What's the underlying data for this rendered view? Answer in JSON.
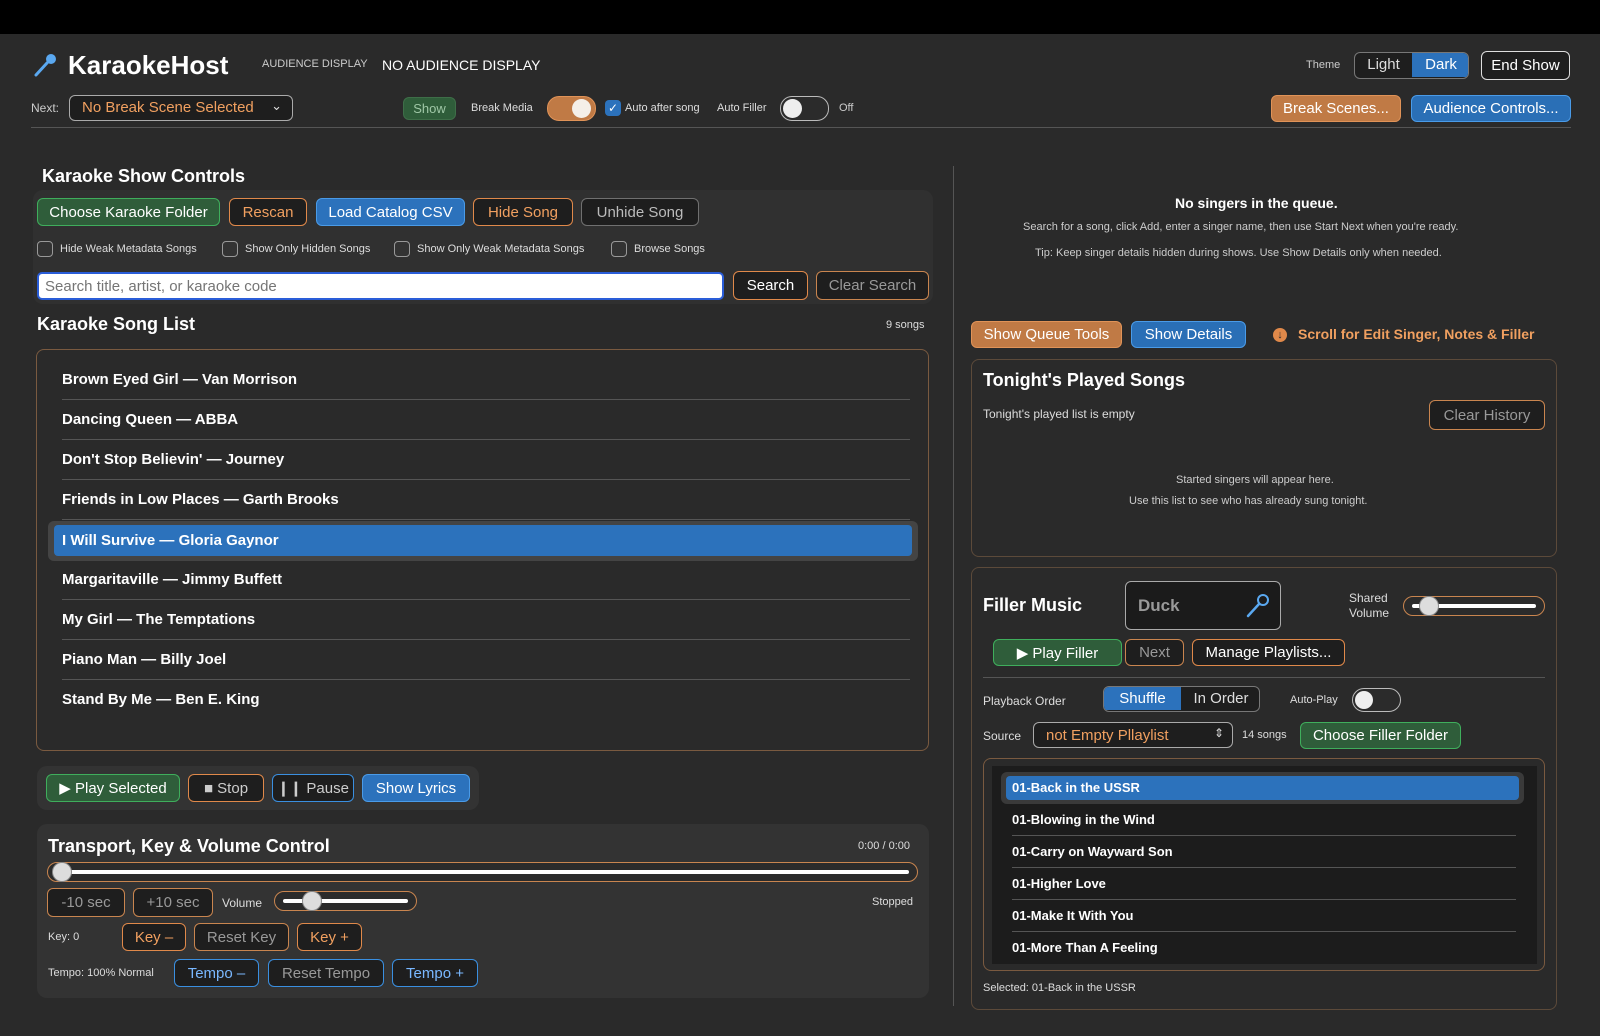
{
  "header": {
    "app_title": "KaraokeHost",
    "audience_display_label": "AUDIENCE DISPLAY",
    "audience_display_value": "NO AUDIENCE DISPLAY",
    "theme_label": "Theme",
    "theme_light": "Light",
    "theme_dark": "Dark",
    "end_show": "End Show",
    "next_label": "Next:",
    "next_select": "No Break Scene Selected",
    "show_btn": "Show",
    "break_media_label": "Break Media",
    "auto_after_song_label": "Auto after song",
    "auto_filler_label": "Auto Filler",
    "auto_filler_state": "Off",
    "break_scenes": "Break Scenes...",
    "audience_controls": "Audience Controls..."
  },
  "controls": {
    "title": "Karaoke Show Controls",
    "choose_folder": "Choose Karaoke Folder",
    "rescan": "Rescan",
    "load_csv": "Load Catalog CSV",
    "hide_song": "Hide Song",
    "unhide_song": "Unhide Song",
    "filters": [
      "Hide Weak Metadata Songs",
      "Show Only Hidden Songs",
      "Show Only Weak Metadata Songs",
      "Browse Songs"
    ],
    "search_placeholder": "Search title, artist, or karaoke code",
    "search_btn": "Search",
    "clear_search_btn": "Clear Search"
  },
  "song_list": {
    "title": "Karaoke Song List",
    "count": "9 songs",
    "songs": [
      "Brown Eyed Girl — Van Morrison",
      "Dancing Queen — ABBA",
      "Don't Stop Believin' — Journey",
      "Friends in Low Places — Garth Brooks",
      "I Will Survive — Gloria Gaynor",
      "Margaritaville — Jimmy Buffett",
      "My Girl — The Temptations",
      "Piano Man — Billy Joel",
      "Stand By Me — Ben E. King"
    ],
    "selected_index": 4
  },
  "playback": {
    "play_selected": "▶ Play Selected",
    "stop": "■ Stop",
    "pause": "❙❙ Pause",
    "show_lyrics": "Show Lyrics"
  },
  "transport": {
    "title": "Transport, Key & Volume Control",
    "time": "0:00 / 0:00",
    "back10": "-10 sec",
    "fwd10": "+10 sec",
    "volume_label": "Volume",
    "status": "Stopped",
    "key_label": "Key: 0",
    "key_down": "Key –",
    "reset_key": "Reset Key",
    "key_up": "Key +",
    "tempo_label": "Tempo: 100% Normal",
    "tempo_down": "Tempo –",
    "reset_tempo": "Reset Tempo",
    "tempo_up": "Tempo +",
    "position_fraction": 0.0,
    "volume_fraction": 0.2
  },
  "queue": {
    "empty_title": "No singers in the queue.",
    "empty_hint": "Search for a song, click Add, enter a singer name, then use Start Next when you're ready.",
    "tip": "Tip: Keep singer details hidden during shows. Use Show Details only when needed.",
    "show_queue_tools": "Show Queue Tools",
    "show_details": "Show Details",
    "scroll_hint": "Scroll for Edit Singer, Notes & Filler"
  },
  "played": {
    "title": "Tonight's Played Songs",
    "empty": "Tonight's played list is empty",
    "clear_history": "Clear History",
    "hint1": "Started singers will appear here.",
    "hint2": "Use this list to see who has already sung tonight."
  },
  "filler": {
    "title": "Filler Music",
    "duck": "Duck",
    "shared_volume_label_1": "Shared",
    "shared_volume_label_2": "Volume",
    "shared_volume_fraction": 0.1,
    "play_filler": "▶  Play Filler",
    "next": "Next",
    "manage_playlists": "Manage Playlists...",
    "playback_order_label": "Playback Order",
    "shuffle": "Shuffle",
    "in_order": "In Order",
    "auto_play_label": "Auto-Play",
    "source_label": "Source",
    "source_value": "not Empty Pllaylist",
    "song_count": "14 songs",
    "choose_folder": "Choose Filler Folder",
    "songs": [
      "01-Back in the USSR",
      "01-Blowing in the Wind",
      "01-Carry on Wayward Son",
      "01-Higher Love",
      "01-Make It With You",
      "01-More Than A Feeling"
    ],
    "selected_index": 0,
    "selected_text": "Selected: 01-Back in the USSR"
  },
  "colors": {
    "accent_blue": "#2c72bc",
    "accent_orange": "#e0894a",
    "accent_green": "#3fae5c"
  }
}
